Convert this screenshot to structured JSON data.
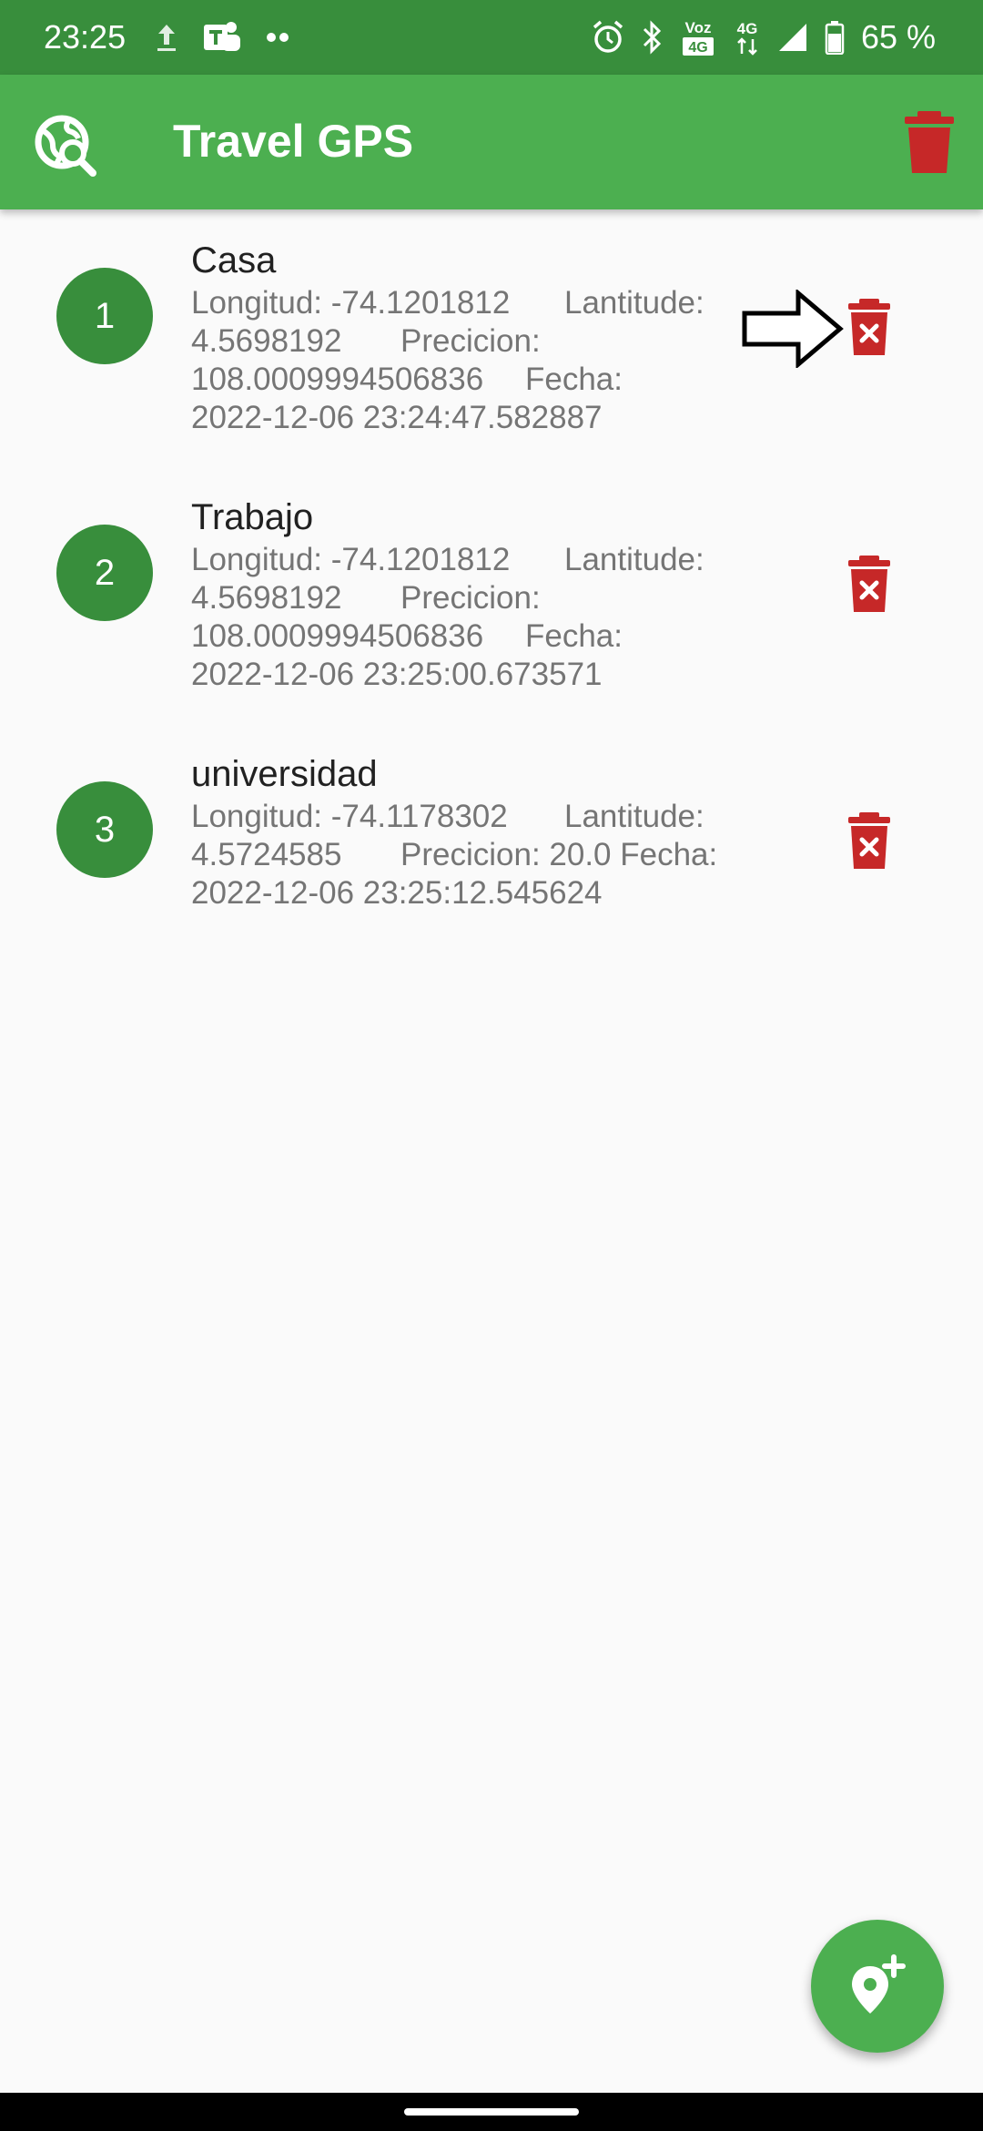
{
  "status_bar": {
    "time": "23:25",
    "icons_left": [
      "upload-icon",
      "teams-icon",
      "more-dots-icon"
    ],
    "icons_right": [
      "alarm-icon",
      "bluetooth-icon",
      "volte-icon",
      "4g-data-icon",
      "signal-icon",
      "battery-icon"
    ],
    "volte_label_top": "Voz",
    "volte_label_bottom": "4G",
    "network_label": "4G",
    "battery": "65 %"
  },
  "app_bar": {
    "title": "Travel GPS",
    "leading_icon": "map-search-icon",
    "action_icon": "trash-icon"
  },
  "locations": [
    {
      "index": "1",
      "name": "Casa",
      "line1": [
        "Longitud:  -74.1201812",
        "Lantitude:"
      ],
      "line2": [
        "4.5698192",
        "Precicion:"
      ],
      "line3": [
        "108.0009994506836",
        "Fecha:"
      ],
      "line4": [
        "2022-12-06 23:24:47.582887",
        ""
      ]
    },
    {
      "index": "2",
      "name": "Trabajo",
      "line1": [
        "Longitud:  -74.1201812",
        "Lantitude:"
      ],
      "line2": [
        "4.5698192",
        "Precicion:"
      ],
      "line3": [
        "108.0009994506836",
        "Fecha:"
      ],
      "line4": [
        "2022-12-06 23:25:00.673571",
        ""
      ]
    },
    {
      "index": "3",
      "name": "universidad",
      "line1": [
        "Longitud:  -74.1178302",
        "Lantitude:"
      ],
      "line2": [
        "4.5724585",
        "Precicion: 20.0   Fecha:"
      ],
      "line3": [
        "2022-12-06 23:25:12.545624",
        ""
      ]
    }
  ],
  "fab": {
    "icon": "add-location-icon"
  },
  "colors": {
    "status_bar": "#388e3c",
    "app_bar": "#4caf50",
    "avatar": "#388e3c",
    "delete_icon": "#c62828",
    "subtitle_text": "#757575"
  }
}
